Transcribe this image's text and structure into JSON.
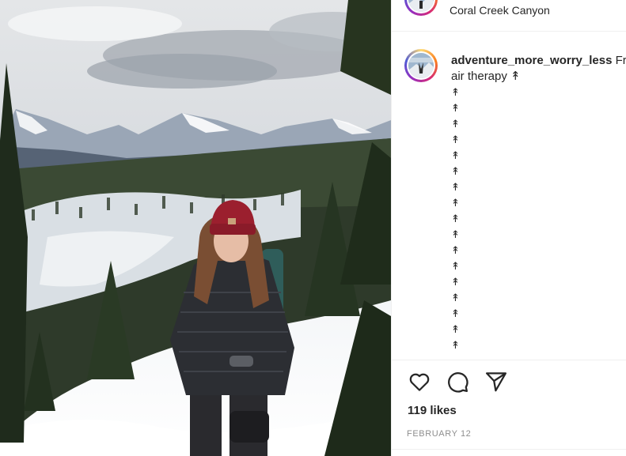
{
  "post": {
    "location": "Coral Creek Canyon",
    "username": "adventure_more_worry_less",
    "caption_start": "Fr",
    "caption_line2": "air therapy ↟",
    "caption_arrows": [
      "↟",
      "↟",
      "↟",
      "↟",
      "↟",
      "↟",
      "↟",
      "↟",
      "↟",
      "↟",
      "↟",
      "↟",
      "↟",
      "↟",
      "↟",
      "↟",
      "↟"
    ],
    "likes": "119 likes",
    "date": "FEBRUARY 12"
  },
  "icons": {
    "like": "heart-icon",
    "comment": "comment-bubble-icon",
    "share": "paper-plane-icon"
  }
}
